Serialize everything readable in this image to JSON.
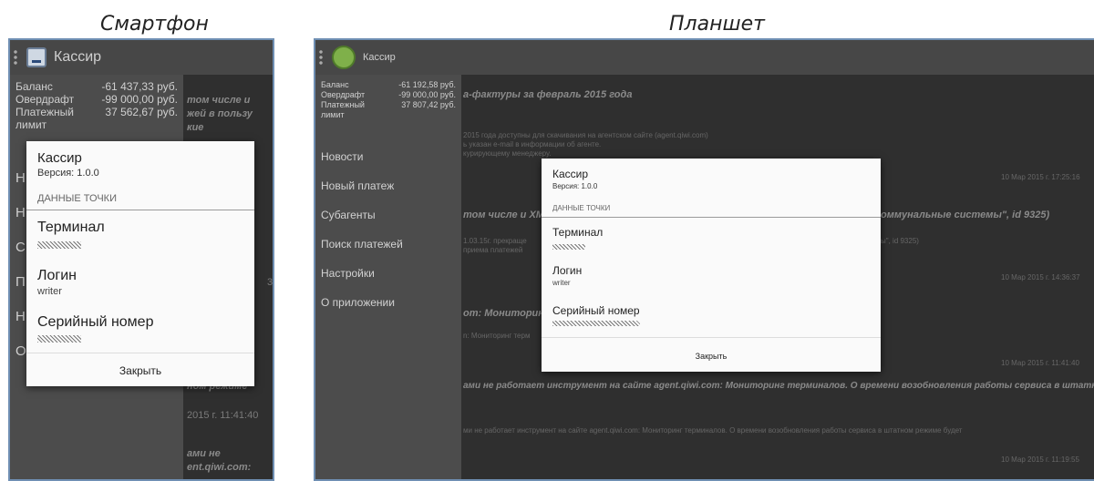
{
  "captions": {
    "phone": "Смартфон",
    "tablet": "Планшет"
  },
  "phone": {
    "appbar_title": "Кассир",
    "balance": [
      {
        "label": "Баланс",
        "value": "-61 437,33 руб."
      },
      {
        "label": "Овердрафт",
        "value": "-99 000,00 руб."
      },
      {
        "label": "Платежный",
        "value": "37 562,67 руб."
      },
      {
        "label": "лимит",
        "value": ""
      }
    ],
    "nav_initials": [
      "Н",
      "Н",
      "С",
      "П",
      "Н",
      "О"
    ],
    "content": {
      "line1": "том числе и",
      "line2": "жей в пользу",
      "line3": "кие",
      "line4": "3",
      "line5": "ном режиме",
      "date": "2015 г. 11:41:40",
      "line6": "ами не",
      "line7": "ent.qiwi.com:"
    },
    "dialog": {
      "title": "Кассир",
      "version": "Версия: 1.0.0",
      "section": "ДАННЫЕ ТОЧКИ",
      "terminal_label": "Терминал",
      "login_label": "Логин",
      "login_value": "writer",
      "serial_label": "Серийный номер",
      "close": "Закрыть"
    }
  },
  "tablet": {
    "appbar_title": "Кассир",
    "balance": [
      {
        "label": "Баланс",
        "value": "-61 192,58 руб."
      },
      {
        "label": "Овердрафт",
        "value": "-99 000,00 руб."
      },
      {
        "label": "Платежный",
        "value": "37 807,42 руб."
      },
      {
        "label": "лимит",
        "value": ""
      }
    ],
    "nav": [
      "Новости",
      "Новый платеж",
      "Субагенты",
      "Поиск платежей",
      "Настройки",
      "О приложении"
    ],
    "content": {
      "h1": "а-фактуры за февраль 2015 года",
      "p1": "2015 года доступны для скачивания на агентском сайте (agent.qiwi.com)",
      "p2": "ь указан e-mail в информации об агенте.",
      "p3": "курирующему менеджеру.",
      "d1": "10 Мар 2015 г. 17:25:16",
      "h2": "том числе и XML",
      "h2b": "оммунальные системы\", id 9325)",
      "p4": "1.03.15г. прекраще",
      "p4b": "ы\", id 9325)",
      "p5": "приема платежей",
      "d2": "10 Мар 2015 г. 14:36:37",
      "h3": "om: Мониторинг те",
      "p6": "n: Мониторинг терм",
      "d3": "10 Мар 2015 г. 11:41:40",
      "h4": "ами не работает инструмент на сайте agent.qiwi.com: Мониторинг терминалов. О времени возобновления работы сервиса в штатном режиме будет",
      "p7": "ми не работает инструмент на сайте agent.qiwi.com: Мониторинг терминалов. О времени возобновления работы сервиса в штатном режиме будет",
      "d4": "10 Мар 2015 г. 11:19:55"
    },
    "dialog": {
      "title": "Кассир",
      "version": "Версия: 1.0.0",
      "section": "ДАННЫЕ ТОЧКИ",
      "terminal_label": "Терминал",
      "login_label": "Логин",
      "login_value": "writer",
      "serial_label": "Серийный номер",
      "close": "Закрыть"
    }
  }
}
